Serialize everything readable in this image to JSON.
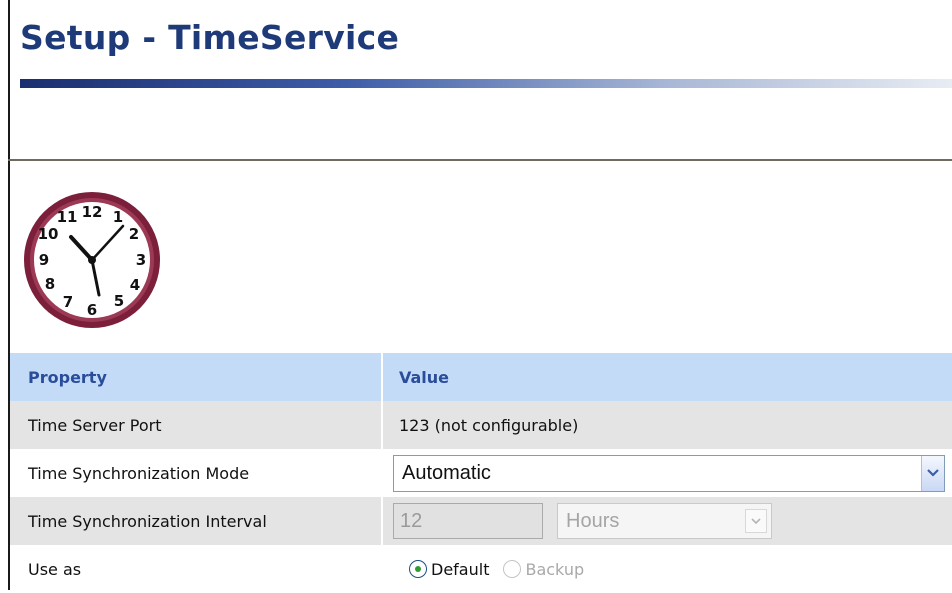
{
  "page": {
    "title": "Setup - TimeService"
  },
  "icons": {
    "clock": "clock-icon",
    "chevron": "chevron-down-icon"
  },
  "colors": {
    "title": "#1f3a78",
    "header_bg": "#c4dbf7",
    "header_text": "#2a4d9b",
    "clock_rim": "#7b1f3b"
  },
  "table": {
    "headers": {
      "property": "Property",
      "value": "Value"
    },
    "rows": {
      "port": {
        "label": "Time Server Port",
        "value": "123 (not configurable)"
      },
      "mode": {
        "label": "Time Synchronization Mode",
        "selected": "Automatic"
      },
      "interval": {
        "label": "Time Synchronization Interval",
        "value": "12",
        "unit": "Hours"
      },
      "use_as": {
        "label": "Use as",
        "option_default": "Default",
        "option_backup": "Backup",
        "selected": "Default"
      }
    }
  },
  "clock_face": {
    "numbers": [
      "12",
      "1",
      "2",
      "3",
      "4",
      "5",
      "6",
      "7",
      "8",
      "9",
      "10",
      "11"
    ]
  }
}
